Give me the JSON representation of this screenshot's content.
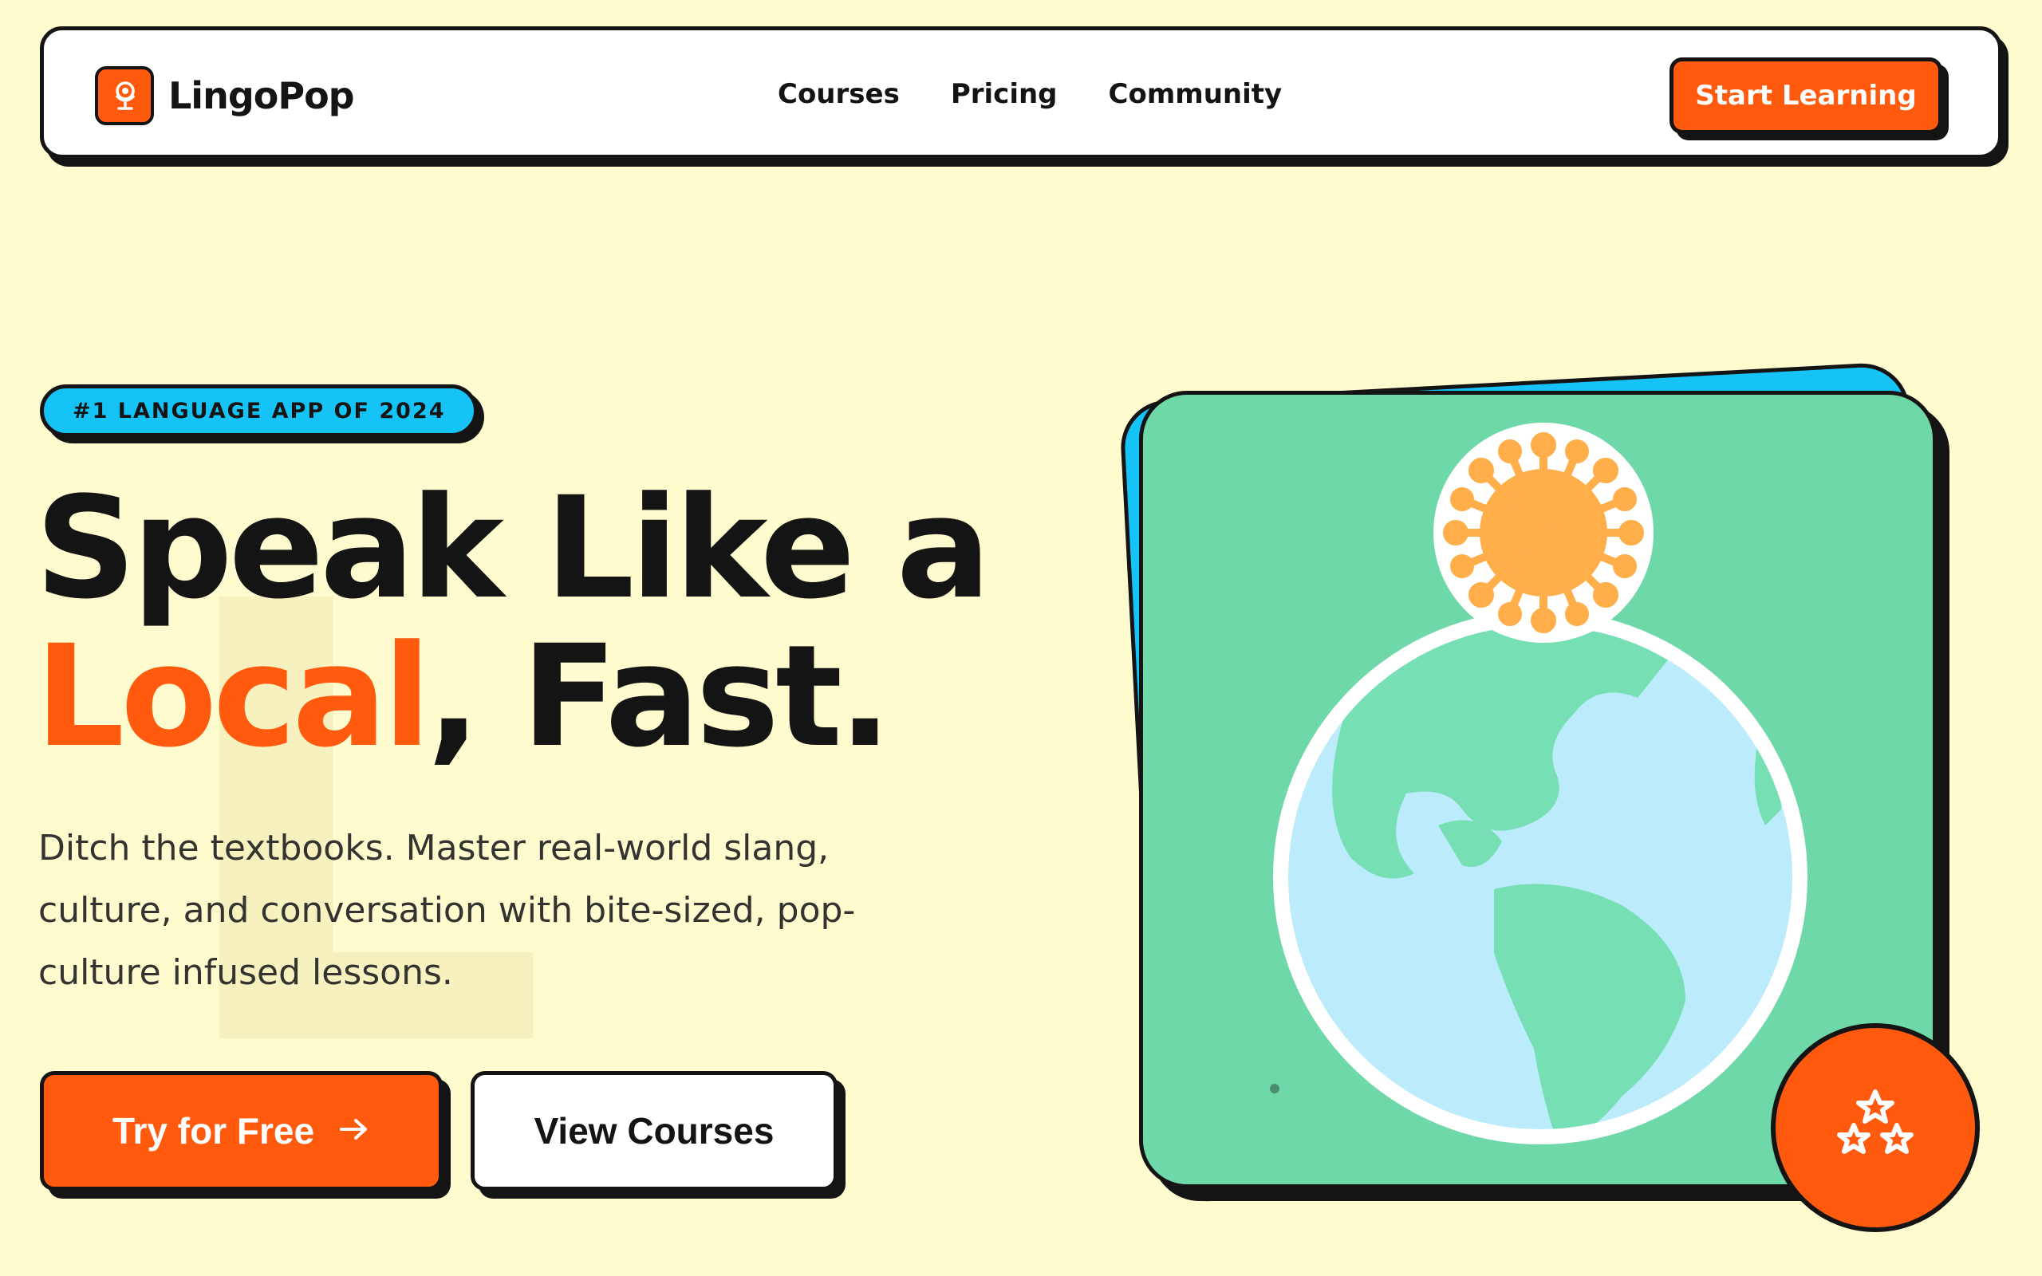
{
  "brand": {
    "name": "LingoPop",
    "logo_icon": "globe-icon",
    "accent": "#FF5A0D",
    "secondary": "#16C3F7",
    "background": "#FEFBCE"
  },
  "nav": {
    "links": [
      "Courses",
      "Pricing",
      "Community"
    ],
    "cta": "Start Learning"
  },
  "hero": {
    "badge": "#1 LANGUAGE APP OF 2024",
    "headline_line1": "Speak Like a",
    "headline_accent": "Local",
    "headline_rest": ", Fast.",
    "subcopy": "Ditch the textbooks. Master real-world slang, culture, and conversation with bite-sized, pop-culture infused lessons.",
    "primary_button": "Try for Free",
    "primary_button_icon": "arrow-right-icon",
    "secondary_button": "View Courses",
    "art_icons": [
      "sun-icon",
      "globe-icon",
      "stars-icon"
    ]
  }
}
